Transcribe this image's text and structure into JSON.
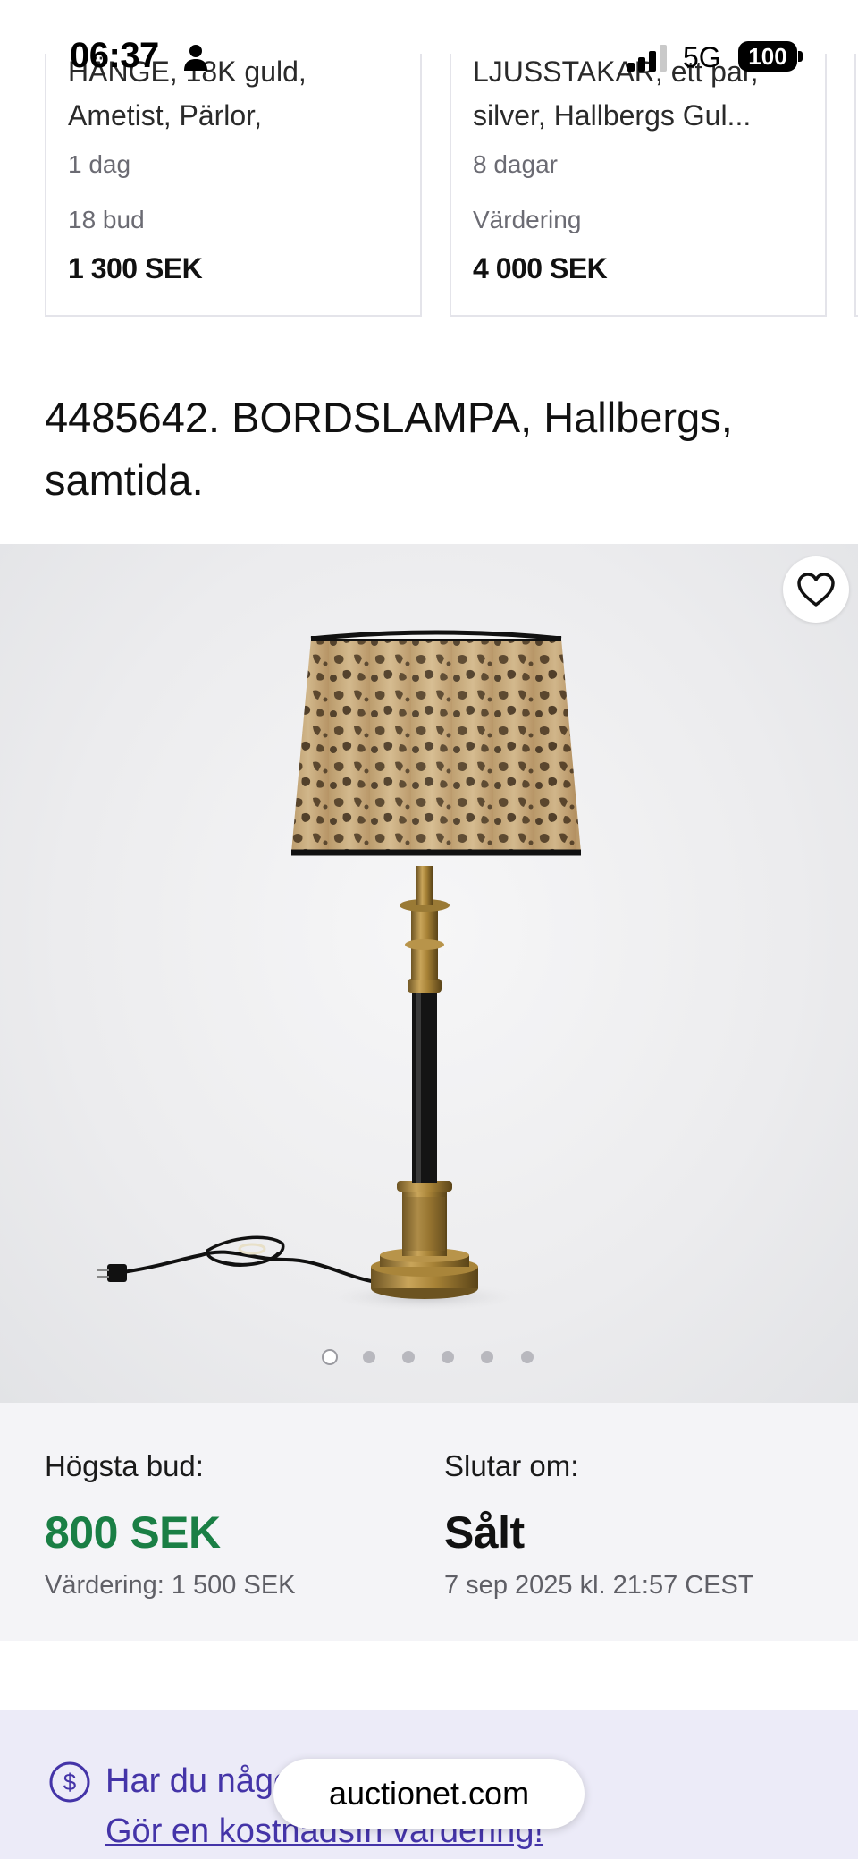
{
  "status_bar": {
    "time": "06:37",
    "network": "5G",
    "battery": "100",
    "icons": [
      "person-icon",
      "signal-icon",
      "battery-icon"
    ]
  },
  "related_cards": [
    {
      "title_line1": "HÄNGE, 18K guld,",
      "title_line2": "Ametist, Pärlor,",
      "time_left": "1 dag",
      "meta": "18 bud",
      "price": "1 300 SEK"
    },
    {
      "title_line1": "LJUSSTAKAR, ett par,",
      "title_line2": "silver, Hallbergs Gul...",
      "time_left": "8 dagar",
      "meta": "Värdering",
      "price": "4 000 SEK"
    }
  ],
  "lot": {
    "title": "4485642. BORDSLAMPA, Hallbergs, samtida.",
    "image_count": 6,
    "active_image": 1,
    "favorite_icon": "heart-icon"
  },
  "bid": {
    "highest_label": "Högsta bud:",
    "highest_value": "800 SEK",
    "valuation": "Värdering: 1 500 SEK",
    "ends_label": "Slutar om:",
    "ends_value": "Sålt",
    "ends_date": "7 sep 2025 kl. 21:57 CEST"
  },
  "valuation_banner": {
    "icon": "dollar-circle-icon",
    "question": "Har du något du vill sälja?",
    "link": "Gör en kostnadsfri värdering!"
  },
  "browser": {
    "url": "auctionet.com"
  },
  "colors": {
    "accent_green": "#1a7f45",
    "accent_purple": "#4434a8",
    "banner_bg": "#ecebf8",
    "bid_bg": "#f4f4f7"
  }
}
